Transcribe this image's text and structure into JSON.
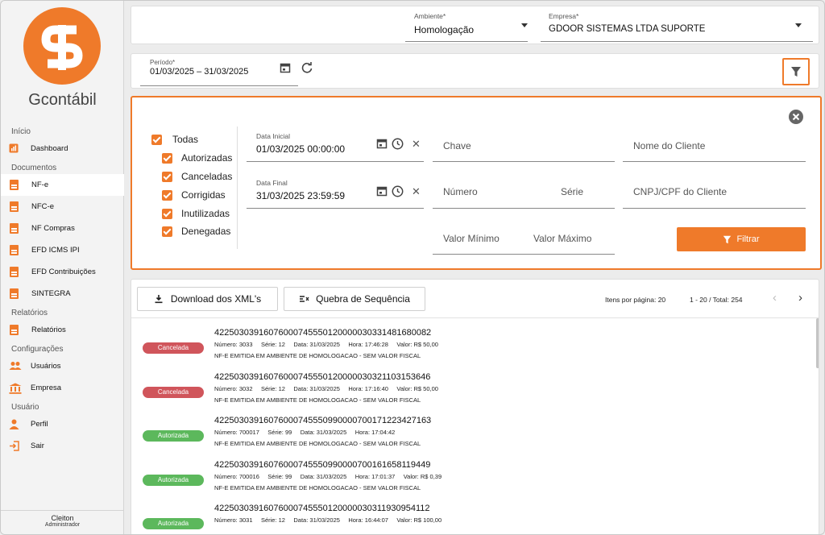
{
  "brand": {
    "name": "Gcontábil",
    "accent": "#ef7a2a"
  },
  "sidebar": {
    "sections": [
      {
        "title": "Início",
        "items": [
          {
            "label": "Dashboard",
            "icon": "chart-icon"
          }
        ]
      },
      {
        "title": "Documentos",
        "items": [
          {
            "label": "NF-e",
            "icon": "document-icon",
            "active": true
          },
          {
            "label": "NFC-e",
            "icon": "document-icon"
          },
          {
            "label": "NF Compras",
            "icon": "document-icon"
          },
          {
            "label": "EFD ICMS IPI",
            "icon": "document-icon"
          },
          {
            "label": "EFD Contribuições",
            "icon": "document-icon"
          },
          {
            "label": "SINTEGRA",
            "icon": "document-icon"
          }
        ]
      },
      {
        "title": "Relatórios",
        "items": [
          {
            "label": "Relatórios",
            "icon": "document-icon"
          }
        ]
      },
      {
        "title": "Configurações",
        "items": [
          {
            "label": "Usuários",
            "icon": "users-icon"
          },
          {
            "label": "Empresa",
            "icon": "bank-icon"
          }
        ]
      },
      {
        "title": "Usuário",
        "items": [
          {
            "label": "Perfil",
            "icon": "person-icon"
          },
          {
            "label": "Sair",
            "icon": "logout-icon"
          }
        ]
      }
    ],
    "user": {
      "name": "Cleiton",
      "role": "Administrador"
    }
  },
  "header": {
    "ambiente_label": "Ambiente*",
    "ambiente_value": "Homologação",
    "empresa_label": "Empresa*",
    "empresa_value": "GDOOR SISTEMAS LTDA SUPORTE"
  },
  "period": {
    "label": "Período*",
    "value": "01/03/2025 – 31/03/2025"
  },
  "filters": {
    "statuses": [
      {
        "label": "Todas"
      },
      {
        "label": "Autorizadas"
      },
      {
        "label": "Canceladas"
      },
      {
        "label": "Corrigidas"
      },
      {
        "label": "Inutilizadas"
      },
      {
        "label": "Denegadas"
      }
    ],
    "data_inicial_label": "Data Inicial",
    "data_inicial_value": "01/03/2025  00:00:00",
    "data_final_label": "Data Final",
    "data_final_value": "31/03/2025  23:59:59",
    "chave_placeholder": "Chave",
    "numero_placeholder": "Número",
    "serie_placeholder": "Série",
    "valor_min_placeholder": "Valor Mínimo",
    "valor_max_placeholder": "Valor Máximo",
    "nome_cliente_placeholder": "Nome do Cliente",
    "cnpj_placeholder": "CNPJ/CPF do Cliente",
    "filtrar_label": "Filtrar"
  },
  "toolbar": {
    "download_label": "Download dos XML's",
    "quebra_label": "Quebra de Sequência",
    "items_per_page_label": "Itens por página:",
    "items_per_page_value": "20",
    "range_label": "1 - 20 / Total: 254"
  },
  "status_colors": {
    "Cancelada": "#d0555b",
    "Autorizada": "#5cb85c"
  },
  "documents": [
    {
      "status": "Cancelada",
      "key": "42250303916076000745550120000030331481680082",
      "numero": "Número: 3033",
      "serie": "Série: 12",
      "data": "Data: 31/03/2025",
      "hora": "Hora: 17:46:28",
      "valor": "Valor: R$ 50,00",
      "note": "NF-E EMITIDA EM AMBIENTE DE HOMOLOGACAO - SEM VALOR FISCAL"
    },
    {
      "status": "Cancelada",
      "key": "42250303916076000745550120000030321103153646",
      "numero": "Número: 3032",
      "serie": "Série: 12",
      "data": "Data: 31/03/2025",
      "hora": "Hora: 17:16:40",
      "valor": "Valor: R$ 50,00",
      "note": "NF-E EMITIDA EM AMBIENTE DE HOMOLOGACAO - SEM VALOR FISCAL"
    },
    {
      "status": "Autorizada",
      "key": "42250303916076000745550990000700171223427163",
      "numero": "Número: 700017",
      "serie": "Série: 99",
      "data": "Data: 31/03/2025",
      "hora": "Hora: 17:04:42",
      "valor": "",
      "note": "NF-E EMITIDA EM AMBIENTE DE HOMOLOGACAO - SEM VALOR FISCAL"
    },
    {
      "status": "Autorizada",
      "key": "42250303916076000745550990000700161658119449",
      "numero": "Número: 700016",
      "serie": "Série: 99",
      "data": "Data: 31/03/2025",
      "hora": "Hora: 17:01:37",
      "valor": "Valor: R$ 0,39",
      "note": "NF-E EMITIDA EM AMBIENTE DE HOMOLOGACAO - SEM VALOR FISCAL"
    },
    {
      "status": "Autorizada",
      "key": "42250303916076000745550120000030311930954112",
      "numero": "Número: 3031",
      "serie": "Série: 12",
      "data": "Data: 31/03/2025",
      "hora": "Hora: 16:44:07",
      "valor": "Valor: R$ 100,00",
      "note": ""
    }
  ]
}
